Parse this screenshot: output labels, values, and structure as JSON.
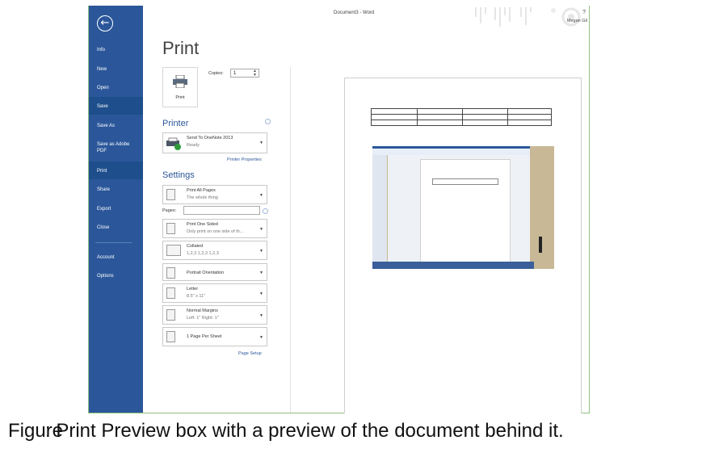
{
  "window": {
    "doc_title": "Document3 - Word",
    "help": "?",
    "user": "Megan Gil"
  },
  "sidebar": {
    "back_icon": "back-arrow-icon",
    "items": [
      {
        "label": "Info"
      },
      {
        "label": "New"
      },
      {
        "label": "Open"
      },
      {
        "label": "Save"
      },
      {
        "label": "Save As"
      },
      {
        "label": "Save as Adobe PDF"
      },
      {
        "label": "Print",
        "active": true
      },
      {
        "label": "Share"
      },
      {
        "label": "Export"
      },
      {
        "label": "Close"
      },
      {
        "label": "Account"
      },
      {
        "label": "Options"
      }
    ]
  },
  "print": {
    "title": "Print",
    "print_button_label": "Print",
    "copies_label": "Copies:",
    "copies_value": "1",
    "printer_heading": "Printer",
    "printer_name": "Send To OneNote 2013",
    "printer_status": "Ready",
    "printer_properties": "Printer Properties",
    "settings_heading": "Settings",
    "pages_label": "Pages:",
    "settings": [
      {
        "line1": "Print All Pages",
        "line2": "The whole thing"
      },
      {
        "line1": "Print One Sided",
        "line2": "Only print on one side of th..."
      },
      {
        "line1": "Collated",
        "line2": "1,2,3   1,2,3   1,2,3"
      },
      {
        "line1": "Portrait Orientation",
        "line2": ""
      },
      {
        "line1": "Letter",
        "line2": "8.5\" x 11\""
      },
      {
        "line1": "Normal Margins",
        "line2": "Left: 1\"   Right: 1\""
      },
      {
        "line1": "1 Page Per Sheet",
        "line2": ""
      }
    ],
    "page_setup": "Page Setup"
  },
  "caption": {
    "prefix": "Figure",
    "text": ": Print Preview box with a preview of the document behind it."
  },
  "colors": {
    "sidebar": "#2b579a",
    "accent": "#2b579a"
  }
}
